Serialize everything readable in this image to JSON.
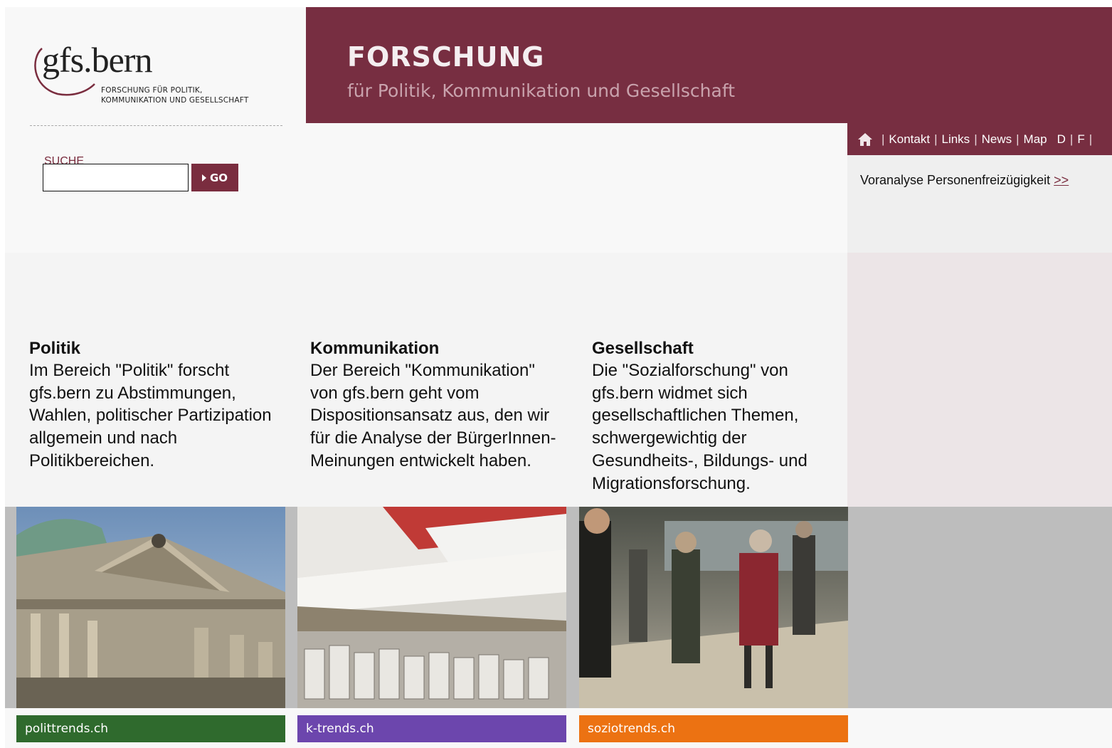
{
  "logo": {
    "word": "gfs.bern",
    "sub_line1": "FORSCHUNG FÜR POLITIK,",
    "sub_line2": "KOMMUNIKATION UND GESELLSCHAFT"
  },
  "header": {
    "title": "FORSCHUNG",
    "subtitle": "für Politik, Kommunikation und Gesellschaft"
  },
  "search": {
    "label": "SUCHE",
    "value": "",
    "button_label": "GO"
  },
  "nav": {
    "items": [
      {
        "label": "Kontakt"
      },
      {
        "label": "Links"
      },
      {
        "label": "News"
      },
      {
        "label": "Map"
      }
    ],
    "lang_d": "D",
    "lang_f": "F"
  },
  "news": {
    "text": "Voranalyse Personenfreizügigkeit",
    "link": ">>"
  },
  "columns": [
    {
      "heading": "Politik",
      "body": "Im Bereich \"Politik\" forscht gfs.bern zu Abstimmungen, Wahlen, politischer Partizipation allgemein und nach Politikbereichen."
    },
    {
      "heading": "Kommunikation",
      "body": "Der Bereich \"Kommunikation\" von gfs.bern geht vom Dispositionsansatz aus, den wir für die Analyse der BürgerInnen-Meinungen entwickelt haben."
    },
    {
      "heading": "Gesellschaft",
      "body": "Die \"Sozialforschung\" von gfs.bern widmet sich gesellschaftlichen Themen, schwergewichtig der Gesundheits-, Bildungs- und Migrationsforschung."
    }
  ],
  "trends": [
    {
      "label": "polittrends.ch",
      "color": "#2f6a2d"
    },
    {
      "label": "k-trends.ch",
      "color": "#6c46ad"
    },
    {
      "label": "soziotrends.ch",
      "color": "#ec7212"
    }
  ],
  "colors": {
    "brand": "#772e41",
    "background": "#f8f8f8"
  }
}
